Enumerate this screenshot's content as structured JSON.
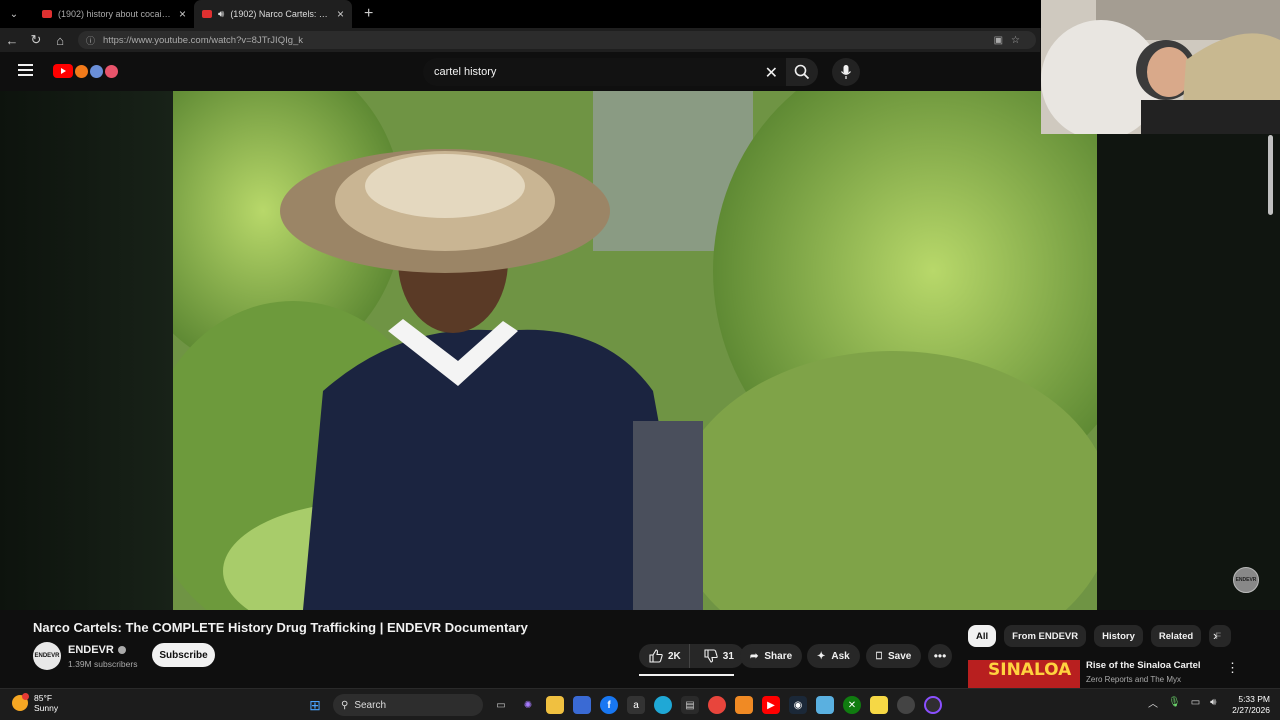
{
  "browser": {
    "tabs": [
      {
        "title": "(1902) history about cocaine - YouTube"
      },
      {
        "title": "(1902) Narco Cartels: The COMPLETE History"
      }
    ],
    "url": "https://www.youtube.com/watch?v=8JTrJIQIg_k"
  },
  "youtube": {
    "search_query": "cartel history",
    "video": {
      "title": "Narco Cartels: The COMPLETE History Drug Trafficking | ENDEVR Documentary",
      "watermark": "ENDEVR"
    },
    "channel": {
      "name": "ENDEVR",
      "avatar_text": "ENDEVR",
      "subscribers": "1.39M subscribers",
      "subscribe_label": "Subscribe"
    },
    "actions": {
      "likes": "2K",
      "dislikes": "31",
      "share": "Share",
      "ask": "Ask",
      "save": "Save"
    },
    "chips": [
      "All",
      "From ENDEVR",
      "History",
      "Related",
      "F"
    ],
    "related": {
      "thumb_text": "SINALOA",
      "title": "Rise of the Sinaloa Cartel",
      "channel": "Zero Reports and The Myx"
    }
  },
  "taskbar": {
    "weather_temp": "85°F",
    "weather_desc": "Sunny",
    "search_label": "Search",
    "time": "5:33 PM",
    "date": "2/27/2026"
  },
  "colors": {
    "accent_red": "#ff0000",
    "background": "#0f0f0f"
  }
}
